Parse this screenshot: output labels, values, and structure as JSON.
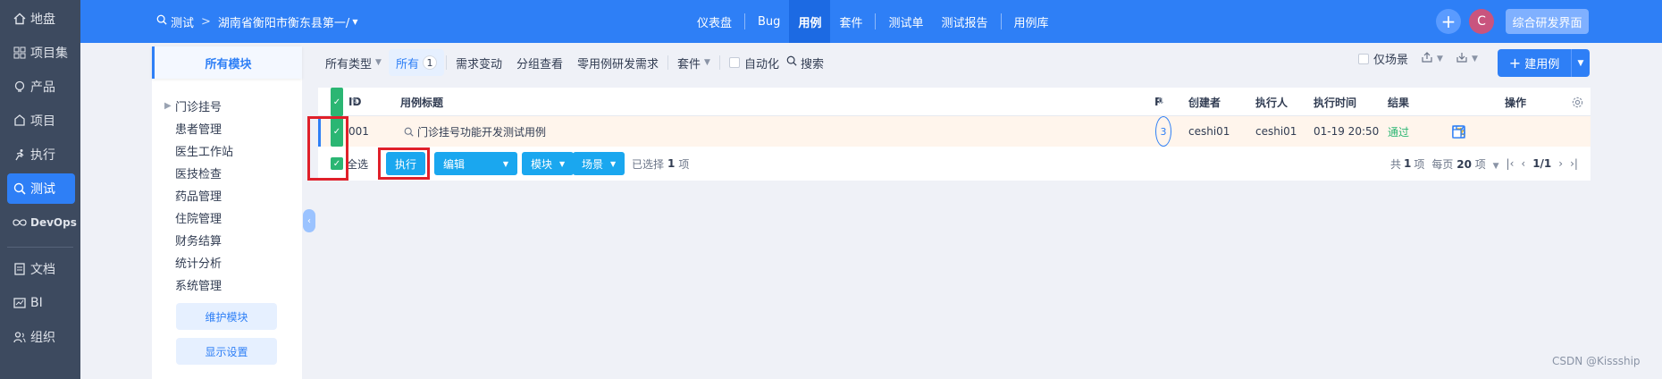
{
  "sidebar": {
    "items": [
      {
        "label": "地盘",
        "icon": "home-icon"
      },
      {
        "label": "项目集",
        "icon": "grid-icon"
      },
      {
        "label": "产品",
        "icon": "lightbulb-icon"
      },
      {
        "label": "项目",
        "icon": "project-icon"
      },
      {
        "label": "执行",
        "icon": "run-icon"
      },
      {
        "label": "测试",
        "icon": "test-icon",
        "active": true
      },
      {
        "label": "DevOps",
        "icon": "infinity-icon"
      },
      {
        "label": "文档",
        "icon": "doc-icon"
      },
      {
        "label": "BI",
        "icon": "chart-icon"
      },
      {
        "label": "组织",
        "icon": "people-icon"
      }
    ]
  },
  "topbar": {
    "breadcrumb_root": "测试",
    "breadcrumb_separator": ">",
    "breadcrumb_current": "湖南省衡阳市衡东县第一/",
    "nav": [
      "仪表盘",
      "Bug",
      "用例",
      "套件",
      "测试单",
      "测试报告",
      "用例库"
    ],
    "active_nav": "用例",
    "plus_symbol": "+",
    "avatar_letter": "C",
    "vision_label": "综合研发界面"
  },
  "modules": {
    "header": "所有模块",
    "items": [
      "门诊挂号",
      "患者管理",
      "医生工作站",
      "医技检查",
      "药品管理",
      "住院管理",
      "财务结算",
      "统计分析",
      "系统管理"
    ],
    "maintain_label": "维护模块",
    "display_label": "显示设置"
  },
  "toolbar": {
    "all_types": "所有类型",
    "all": "所有",
    "all_count": "1",
    "story_change": "需求变动",
    "group_view": "分组查看",
    "zero_case": "零用例研发需求",
    "suite": "套件",
    "automation": "自动化",
    "search": "搜索",
    "scene_only": "仅场景",
    "create_case": "建用例"
  },
  "table": {
    "headers": {
      "id": "ID",
      "title": "用例标题",
      "priority": "P",
      "creator": "创建者",
      "executor": "执行人",
      "exec_time": "执行时间",
      "result": "结果",
      "actions": "操作"
    },
    "row": {
      "id": "001",
      "title": "门诊挂号功能开发测试用例",
      "priority": "3",
      "creator": "ceshi01",
      "executor": "ceshi01",
      "exec_time": "01-19 20:50",
      "result": "通过"
    }
  },
  "footer": {
    "select_all": "全选",
    "execute": "执行",
    "edit": "编辑",
    "module": "模块",
    "scene": "场景",
    "selected_text": "已选择",
    "selected_count": "1",
    "selected_unit": "项",
    "total_text": "共",
    "total_count": "1",
    "total_unit": "项",
    "per_page_text": "每页",
    "per_page_count": "20",
    "per_page_unit": "项",
    "page": "1/1"
  },
  "watermark": "CSDN @Kissship",
  "colors": {
    "primary": "#2e7ff6",
    "sidebar": "#3d4a5f",
    "success": "#2bb673",
    "highlight": "#e0202a"
  }
}
